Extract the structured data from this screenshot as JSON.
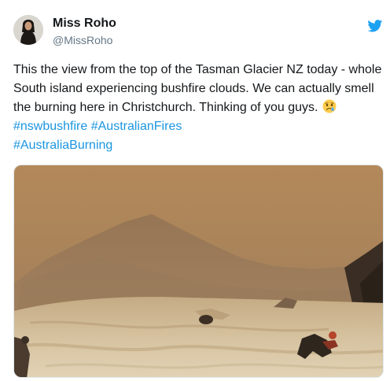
{
  "author": {
    "display_name": "Miss Roho",
    "handle": "@MissRoho",
    "avatar_icon": "avatar-photo"
  },
  "platform_icon": "twitter-bird-icon",
  "tweet": {
    "text": "This the view from the top of the Tasman Glacier NZ today - whole South island experiencing bushfire clouds. We can actually smell the burning here in Christchurch. Thinking of you guys.",
    "emoji": "crying-face-emoji",
    "hashtags": [
      "#nswbushfire",
      "#AustralianFires",
      "#AustraliaBurning"
    ]
  },
  "media": {
    "type": "photo",
    "subject": "smoke-filled orange sky over glacier with climbers"
  },
  "colors": {
    "text": "#14171a",
    "secondary": "#657786",
    "link": "#1b95e0",
    "brand": "#1da1f2"
  }
}
